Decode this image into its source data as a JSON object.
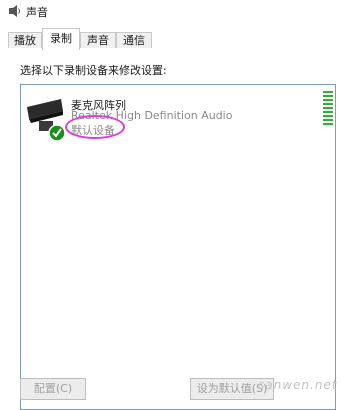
{
  "window": {
    "title": "声音"
  },
  "tabs": [
    {
      "label": "播放"
    },
    {
      "label": "录制"
    },
    {
      "label": "声音"
    },
    {
      "label": "通信"
    }
  ],
  "active_tab": "录制",
  "instruction": "选择以下录制设备来修改设置:",
  "devices": [
    {
      "name": "麦克风阵列",
      "driver": "Realtek High Definition Audio",
      "status": "默认设备",
      "status_icon": "check-icon",
      "level": 0.9
    }
  ],
  "buttons": {
    "configure": "配置(C)",
    "set_default": "设为默认值(S)"
  },
  "watermark": "sanwen.net",
  "colors": {
    "highlight": "#e03ae0",
    "level_meter": "#2fb12f",
    "check_badge": "#1a8f1a"
  }
}
